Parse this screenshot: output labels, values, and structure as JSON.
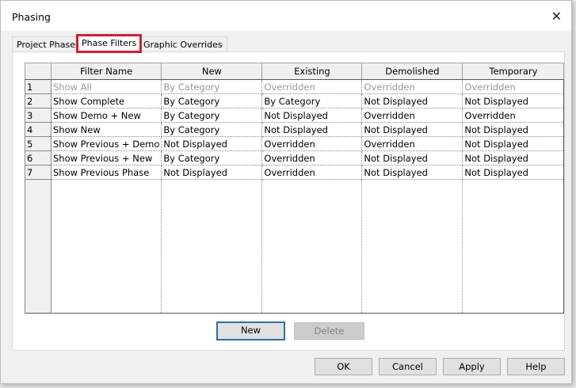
{
  "window": {
    "title": "Phasing"
  },
  "tabs": [
    {
      "label": "Project Phases"
    },
    {
      "label": "Phase Filters"
    },
    {
      "label": "Graphic Overrides"
    }
  ],
  "grid": {
    "columns": [
      "Filter Name",
      "New",
      "Existing",
      "Demolished",
      "Temporary"
    ],
    "rows": [
      {
        "num": "1",
        "cells": [
          "Show All",
          "By Category",
          "Overridden",
          "Overridden",
          "Overridden"
        ]
      },
      {
        "num": "2",
        "cells": [
          "Show Complete",
          "By Category",
          "By Category",
          "Not Displayed",
          "Not Displayed"
        ]
      },
      {
        "num": "3",
        "cells": [
          "Show Demo + New",
          "By Category",
          "Not Displayed",
          "Overridden",
          "Overridden"
        ]
      },
      {
        "num": "4",
        "cells": [
          "Show New",
          "By Category",
          "Not Displayed",
          "Not Displayed",
          "Not Displayed"
        ]
      },
      {
        "num": "5",
        "cells": [
          "Show Previous + Demo",
          "Not Displayed",
          "Overridden",
          "Overridden",
          "Not Displayed"
        ]
      },
      {
        "num": "6",
        "cells": [
          "Show Previous + New",
          "By Category",
          "Overridden",
          "Not Displayed",
          "Not Displayed"
        ]
      },
      {
        "num": "7",
        "cells": [
          "Show Previous Phase",
          "Not Displayed",
          "Overridden",
          "Not Displayed",
          "Not Displayed"
        ]
      }
    ]
  },
  "buttons": {
    "new": "New",
    "delete": "Delete",
    "ok": "OK",
    "cancel": "Cancel",
    "apply": "Apply",
    "help": "Help"
  },
  "icons": {
    "close": "close-icon"
  }
}
